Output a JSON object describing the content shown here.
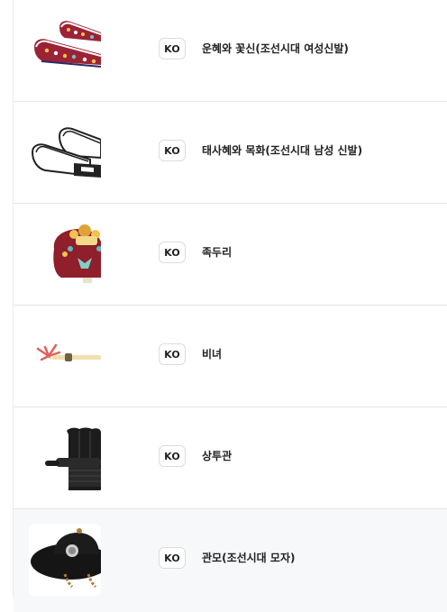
{
  "items": [
    {
      "lang": "KO",
      "title": "운혜와 꽃신(조선시대 여성신발)",
      "thumb_icon": "embroidered-shoes-icon"
    },
    {
      "lang": "KO",
      "title": "태사혜와 목화(조선시대 남성 신발)",
      "thumb_icon": "mens-shoes-icon"
    },
    {
      "lang": "KO",
      "title": "족두리",
      "thumb_icon": "jokduri-crown-icon"
    },
    {
      "lang": "KO",
      "title": "비녀",
      "thumb_icon": "hairpin-icon"
    },
    {
      "lang": "KO",
      "title": "상투관",
      "thumb_icon": "topknot-cap-icon"
    },
    {
      "lang": "KO",
      "title": "관모(조선시대 모자)",
      "thumb_icon": "gat-hat-icon"
    }
  ],
  "colors": {
    "row_border": "#e6e6e6",
    "selected_row_bg": "#f7f8fa",
    "shoe_red": "#9b2335",
    "crown_red": "#8e1f2b"
  }
}
